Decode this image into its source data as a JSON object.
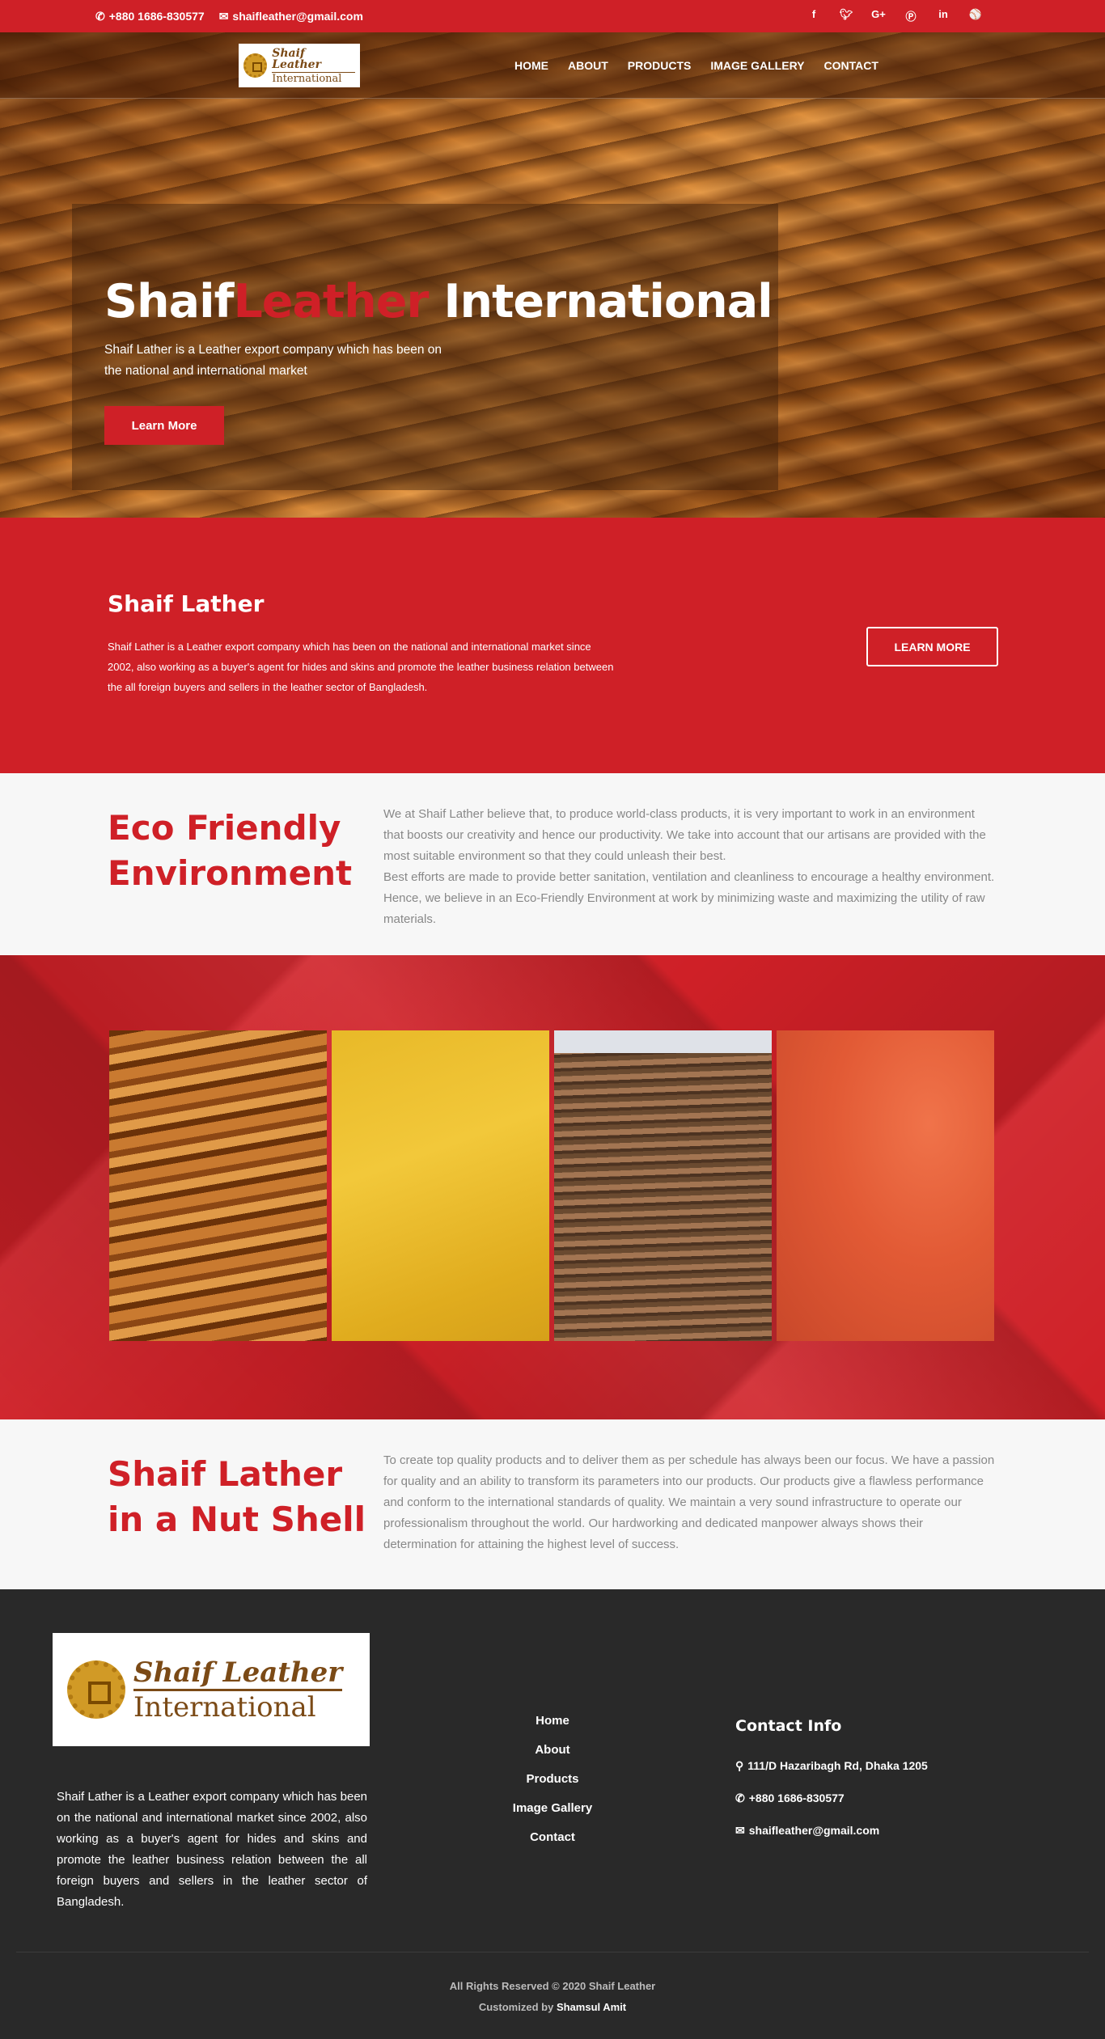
{
  "topbar": {
    "phone_icon": "phone-icon",
    "phone": "+880 1686-830577",
    "email_icon": "envelope-icon",
    "email": "shaifleather@gmail.com",
    "social": [
      "facebook-icon",
      "twitter-icon",
      "google-plus-icon",
      "pinterest-icon",
      "linkedin-icon",
      "dribbble-icon"
    ]
  },
  "logo": {
    "line1": "Shaif Leather",
    "line2": "International"
  },
  "nav": {
    "home": "HOME",
    "about": "ABOUT",
    "products": "PRODUCTS",
    "gallery": "IMAGE GALLERY",
    "contact": "CONTACT"
  },
  "hero": {
    "title_a": "Shaif",
    "title_b": "Leather",
    "title_c": " International",
    "subtitle": "Shaif Lather is a Leather export company which has been on the national and international market",
    "button": "Learn More"
  },
  "about": {
    "heading": "Shaif Lather",
    "text": "Shaif Lather is a Leather export company which has been on the national and international market since 2002, also working as a buyer's agent for hides and skins and promote the leather business relation between the all foreign buyers and sellers in the leather sector of Bangladesh.",
    "button": "LEARN MORE"
  },
  "eco": {
    "heading": "Eco Friendly Environment",
    "p1": "We at Shaif Lather believe that, to produce world-class products, it is very important to work in an environment that boosts our creativity and hence our productivity. We take into account that our artisans are provided with the most suitable environment so that they could unleash their best.",
    "p2": "Best efforts are made to provide better sanitation, ventilation and cleanliness to encourage a healthy environment. Hence, we believe in an Eco-Friendly Environment at work by minimizing waste and maximizing the utility of raw materials."
  },
  "nutshell": {
    "heading": "Shaif Lather in a Nut Shell",
    "text": "To create top quality products and to deliver them as per schedule has always been our focus. We have a passion for quality and an ability to transform its parameters into our products. Our products give a flawless performance and conform to the international standards of quality. We maintain a very sound infrastructure to operate our professionalism throughout the world. Our hardworking and dedicated manpower always shows their determination for attaining the highest level of success."
  },
  "footer": {
    "logo_line1": "Shaif Leather",
    "logo_line2": "International",
    "desc": "Shaif Lather is a Leather export company which has been on the national and international market since 2002, also working as a buyer's agent for hides and skins and promote the leather business relation between the all foreign buyers and sellers in the leather sector of Bangladesh.",
    "links": [
      "Home",
      "About",
      "Products",
      "Image Gallery",
      "Contact"
    ],
    "contact_heading": "Contact Info",
    "address": "111/D Hazaribagh Rd, Dhaka 1205",
    "phone": "+880 1686-830577",
    "email": "shaifleather@gmail.com",
    "copyright": "All Rights Reserved © 2020 Shaif Leather",
    "credit_prefix": "Customized by",
    "credit_name": "Shamsul Amit"
  },
  "colors": {
    "brand_red": "#cf2027",
    "footer_bg": "#292929",
    "section_bg": "#f7f7f7"
  }
}
